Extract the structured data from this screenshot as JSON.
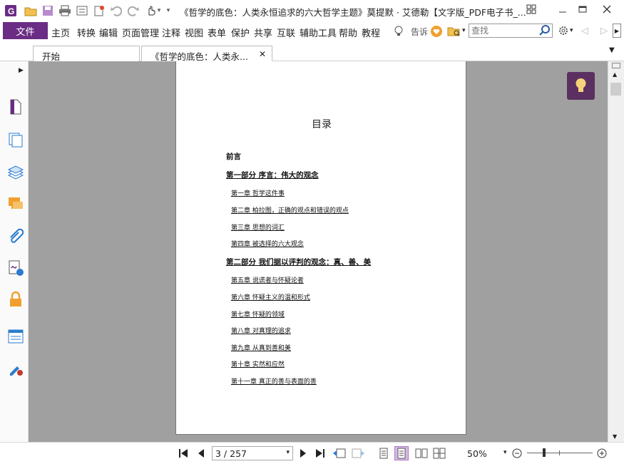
{
  "window": {
    "title": "《哲学的底色：人类永恒追求的六大哲学主题》莫提默 · 艾德勒【文字版_PDF电子书_..."
  },
  "menu": {
    "file": "文件",
    "items": [
      "主页",
      "转换",
      "编辑",
      "页面管理",
      "注释",
      "视图",
      "表单",
      "保护",
      "共享",
      "互联",
      "辅助工具",
      "帮助",
      "教程"
    ],
    "tell_me": "告诉",
    "search_placeholder": "查找"
  },
  "tabs": [
    {
      "label": "开始"
    },
    {
      "label": "《哲学的底色：人类永..."
    }
  ],
  "document": {
    "heading": "目录",
    "preface": "前言",
    "toc": [
      {
        "kind": "part",
        "text": "第一部分 序言：伟大的观念"
      },
      {
        "kind": "chap",
        "text": "第一章 哲学这件事"
      },
      {
        "kind": "chap",
        "text": "第二章 柏拉图，正确的观点和错误的观点"
      },
      {
        "kind": "chap",
        "text": "第三章 思想的词汇"
      },
      {
        "kind": "chap",
        "text": "第四章 被选择的六大观念"
      },
      {
        "kind": "part",
        "text": "第二部分 我们据以评判的观念：真、善、美"
      },
      {
        "kind": "chap",
        "text": "第五章 说谎者与怀疑论者"
      },
      {
        "kind": "chap",
        "text": "第六章 怀疑主义的温和形式"
      },
      {
        "kind": "chap",
        "text": "第七章 怀疑的领域"
      },
      {
        "kind": "chap",
        "text": "第八章 对真理的追求"
      },
      {
        "kind": "chap",
        "text": "第九章 从真到善和美"
      },
      {
        "kind": "chap",
        "text": "第十章 实然和应然"
      },
      {
        "kind": "chap",
        "text": "第十一章 真正的善与表面的善"
      }
    ]
  },
  "status": {
    "page_indicator": "3 / 257",
    "zoom": "50%"
  },
  "colors": {
    "accent": "#6a2c84",
    "doc_background": "#a0a0a0",
    "bulb_bg": "#5b3060"
  }
}
